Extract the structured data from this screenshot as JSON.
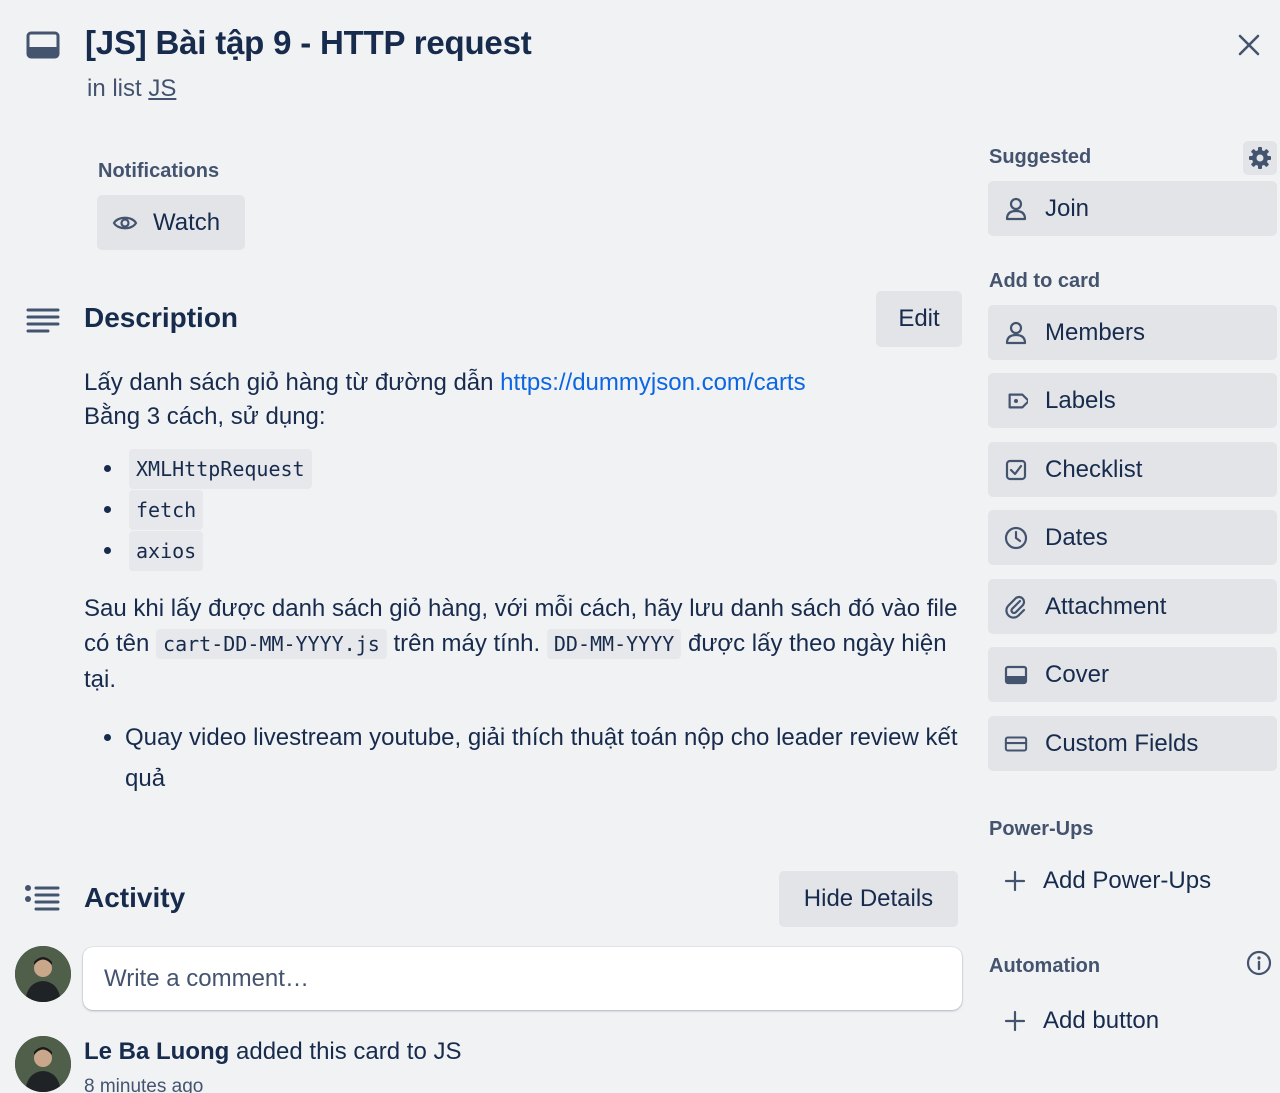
{
  "header": {
    "title": "[JS] Bài tập 9 - HTTP request",
    "in_list_prefix": "in list",
    "list_name": "JS"
  },
  "notifications": {
    "label": "Notifications",
    "watch_label": "Watch"
  },
  "description": {
    "title": "Description",
    "edit_label": "Edit",
    "line1_text": "Lấy danh sách giỏ hàng từ đường dẫn ",
    "line1_link": "https://dummyjson.com/carts",
    "line2": "Bằng 3 cách, sử dụng:",
    "methods": [
      "XMLHttpRequest",
      "fetch",
      "axios"
    ],
    "para_part1": "Sau khi lấy được danh sách giỏ hàng, với mỗi cách, hãy lưu danh sách đó vào file có tên ",
    "para_code1": "cart-DD-MM-YYYY.js",
    "para_part2": " trên máy tính. ",
    "para_code2": "DD-MM-YYYY",
    "para_part3": " được lấy theo ngày hiện tại.",
    "task": "Quay video livestream youtube, giải thích thuật toán nộp cho leader review kết quả"
  },
  "activity": {
    "title": "Activity",
    "hide_details_label": "Hide Details",
    "comment_placeholder": "Write a comment…",
    "entries": [
      {
        "user": "Le Ba Luong",
        "action": " added this card to JS",
        "time": "8 minutes ago"
      }
    ]
  },
  "sidebar": {
    "suggested_label": "Suggested",
    "join_label": "Join",
    "add_to_card_label": "Add to card",
    "add_to_card_items": [
      {
        "label": "Members",
        "icon": "person-icon"
      },
      {
        "label": "Labels",
        "icon": "tag-icon"
      },
      {
        "label": "Checklist",
        "icon": "checkbox-icon"
      },
      {
        "label": "Dates",
        "icon": "clock-icon"
      },
      {
        "label": "Attachment",
        "icon": "paperclip-icon"
      },
      {
        "label": "Cover",
        "icon": "cover-icon"
      },
      {
        "label": "Custom Fields",
        "icon": "custom-fields-icon"
      }
    ],
    "powerups_label": "Power-Ups",
    "add_powerups_label": "Add Power-Ups",
    "automation_label": "Automation",
    "add_button_label": "Add button"
  },
  "colors": {
    "background": "#f1f2f4",
    "button_bg": "#e2e4e8",
    "text": "#172b4d",
    "subtle_text": "#44546f",
    "link": "#0c66e4"
  }
}
